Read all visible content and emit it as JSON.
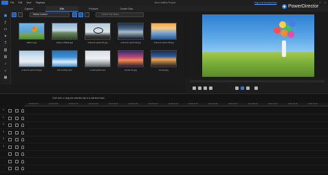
{
  "app": {
    "title": "New Untitled Project",
    "signin_label": "Sign in to DirectorZone",
    "brand": "PowerDirector",
    "menu": [
      "File",
      "Edit",
      "View",
      "Playback"
    ]
  },
  "modes": {
    "tabs": [
      "Capture",
      "Edit",
      "Produce",
      "Create Disc"
    ],
    "active": "Edit"
  },
  "library": {
    "filter_value": "Media Content",
    "search_placeholder": "Search the library",
    "items": [
      {
        "label": "balloon.jpg"
      },
      {
        "label": "beach_hillside.jpg"
      },
      {
        "label": "extreme sports 01.jpg"
      },
      {
        "label": "extreme sports 02.jpg"
      },
      {
        "label": "extreme sports 03.jpg"
      },
      {
        "label": "extreme sports 04.jpg"
      },
      {
        "label": "fish surfing.mp4"
      },
      {
        "label": "motorcycles.mpo"
      },
      {
        "label": "sunset 01.jpg"
      },
      {
        "label": "sunset.jpg"
      }
    ]
  },
  "timeline": {
    "hint": "Click here or drag the selected clip to a selected track.",
    "ruler": [
      "00:00:00:00",
      "00:00:05:00",
      "00:00:10:00",
      "00:00:15:00",
      "00:00:20:00",
      "00:00:25:00",
      "00:00:30:00",
      "00:00:35:00",
      "00:00:40:00",
      "00:00:45:00",
      "00:00:50:00",
      "00:00:55:00",
      "00:01:00:00",
      "00:01:05:00",
      "00:01:10:00"
    ],
    "tracks": [
      "1.",
      "1.",
      "2.",
      "2.",
      "3.",
      "3.",
      "",
      "",
      ""
    ]
  },
  "colors": {
    "accent": "#3a7fd8",
    "background": "#1a1a1a"
  }
}
